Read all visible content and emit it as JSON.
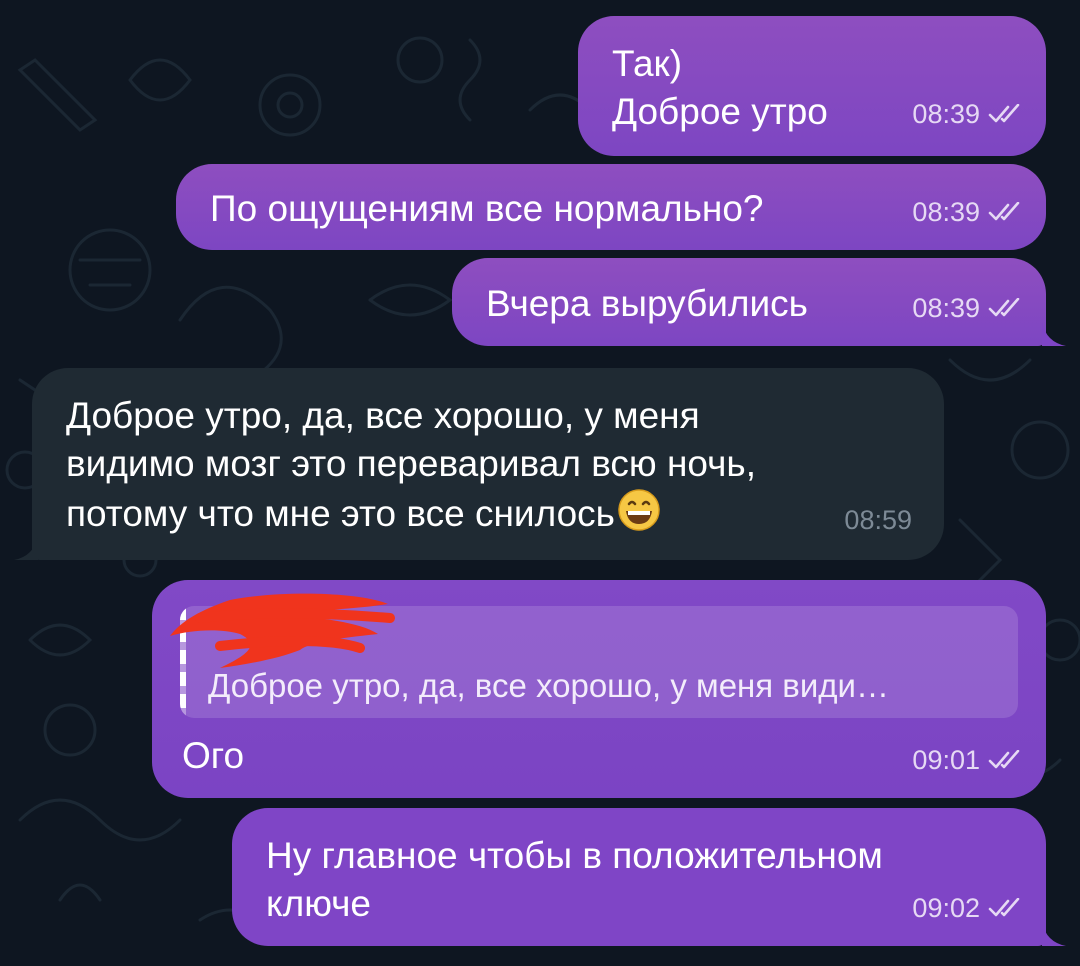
{
  "messages": [
    {
      "id": "msg1",
      "direction": "outgoing",
      "lines": [
        "Так)",
        "Доброе утро"
      ],
      "time": "08:39",
      "status": "read"
    },
    {
      "id": "msg2",
      "direction": "outgoing",
      "lines": [
        "По ощущениям все нормально?"
      ],
      "time": "08:39",
      "status": "read"
    },
    {
      "id": "msg3",
      "direction": "outgoing",
      "lines": [
        "Вчера вырубились"
      ],
      "time": "08:39",
      "status": "read"
    },
    {
      "id": "msg4",
      "direction": "incoming",
      "lines": [
        "Доброе утро, да, все хорошо, у меня",
        "видимо мозг это переваривал всю ночь,",
        "потому что мне это все снилось"
      ],
      "emoji": "😄",
      "time": "08:59"
    },
    {
      "id": "msg5",
      "direction": "outgoing",
      "reply": {
        "author_redacted": true,
        "quote": "Доброе утро, да, все хорошо, у меня види…"
      },
      "lines": [
        "Ого"
      ],
      "time": "09:01",
      "status": "read"
    },
    {
      "id": "msg6",
      "direction": "outgoing",
      "lines": [
        "Ну главное чтобы в положительном",
        "ключе"
      ],
      "time": "09:02",
      "status": "read"
    }
  ],
  "colors": {
    "background": "#0e1621",
    "outgoing_bubble": "#8244c4",
    "incoming_bubble": "#1f2a33",
    "redaction": "#f0341d"
  },
  "icons": {
    "read_status": "double-check-icon",
    "emoji": "grinning-face-icon"
  }
}
